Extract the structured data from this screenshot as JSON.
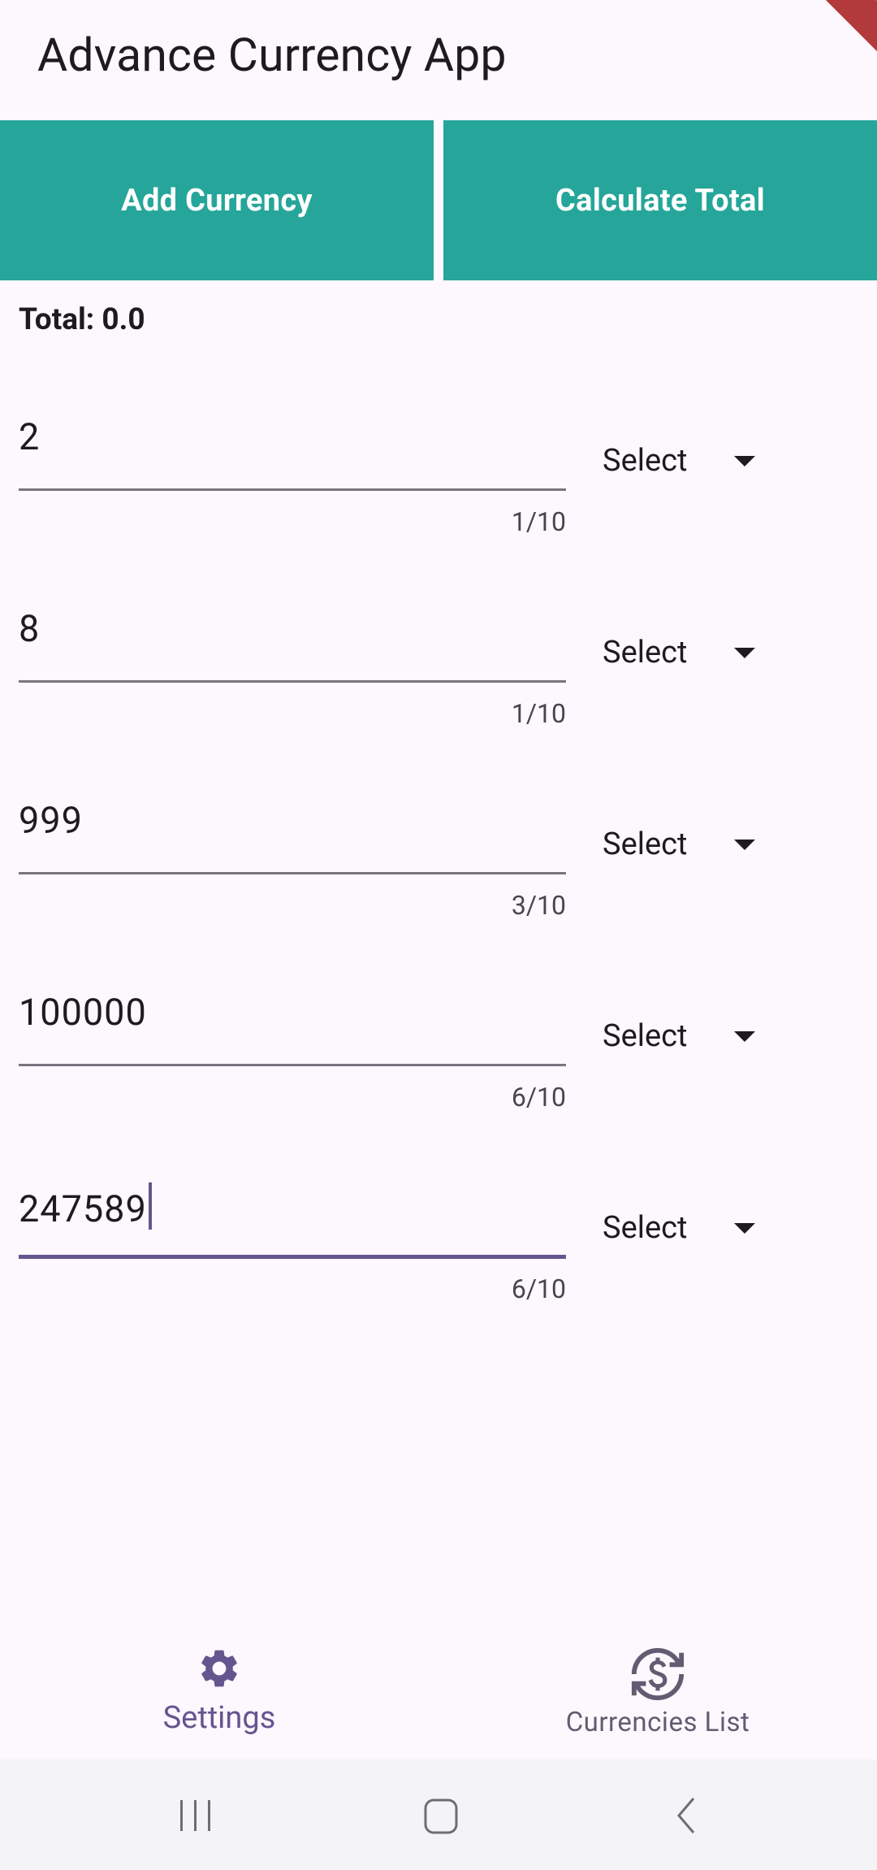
{
  "app": {
    "title": "Advance Currency App"
  },
  "actions": {
    "add_label": "Add Currency",
    "calc_label": "Calculate Total"
  },
  "total": {
    "label": "Total: 0.0"
  },
  "rows": [
    {
      "value": "2",
      "counter": "1/10",
      "select": "Select"
    },
    {
      "value": "8",
      "counter": "1/10",
      "select": "Select"
    },
    {
      "value": "999",
      "counter": "3/10",
      "select": "Select"
    },
    {
      "value": "100000",
      "counter": "6/10",
      "select": "Select"
    },
    {
      "value": "247589",
      "counter": "6/10",
      "select": "Select"
    }
  ],
  "bottom_nav": {
    "items": [
      {
        "label": "Settings",
        "icon": "gear-icon",
        "active": true
      },
      {
        "label": "Currencies List",
        "icon": "currency-exchange-icon",
        "active": false
      }
    ]
  },
  "colors": {
    "primary": "#26A69A",
    "accent": "#65558F",
    "background": "#FDF7FE"
  },
  "system_nav": {
    "icons": [
      "recent-apps-icon",
      "home-icon",
      "back-icon"
    ]
  }
}
